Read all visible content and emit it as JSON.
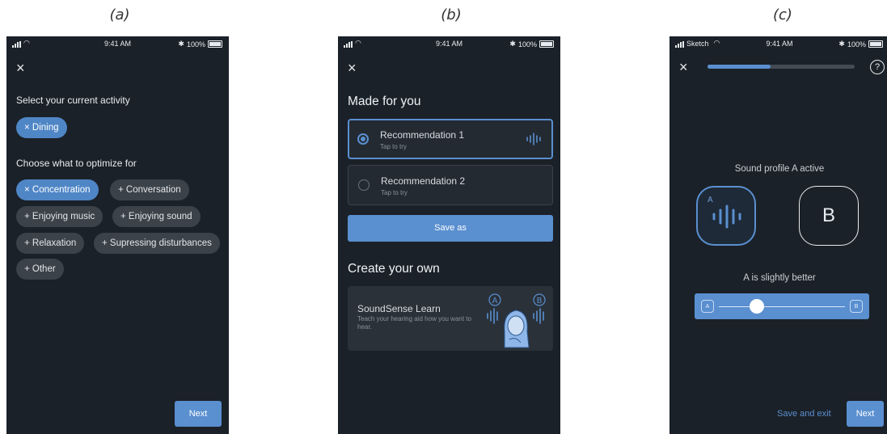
{
  "captions": {
    "a": "(a)",
    "b": "(b)",
    "c": "(c)"
  },
  "status": {
    "time": "9:41 AM",
    "battery": "100%",
    "carrier_c": "Sketch"
  },
  "screen_a": {
    "close_icon": "×",
    "activity_heading": "Select your current activity",
    "activity_chip": "× Dining",
    "optimize_heading": "Choose what to optimize for",
    "chips": [
      {
        "label": "× Concentration",
        "selected": true
      },
      {
        "label": "+ Conversation",
        "selected": false
      },
      {
        "label": "+ Enjoying music",
        "selected": false
      },
      {
        "label": "+ Enjoying sound",
        "selected": false
      },
      {
        "label": "+ Relaxation",
        "selected": false
      },
      {
        "label": "+ Supressing disturbances",
        "selected": false
      },
      {
        "label": "+ Other",
        "selected": false
      }
    ],
    "next_label": "Next"
  },
  "screen_b": {
    "close_icon": "×",
    "made_heading": "Made for you",
    "rec1_title": "Recommendation 1",
    "rec1_sub": "Tap to try",
    "rec2_title": "Recommendation 2",
    "rec2_sub": "Tap to try",
    "save_label": "Save as",
    "create_heading": "Create your own",
    "learn_title": "SoundSense Learn",
    "learn_desc": "Teach your hearing aid how you want to hear.",
    "learn_a": "A",
    "learn_b": "B"
  },
  "screen_c": {
    "close_icon": "×",
    "help_icon": "?",
    "progress": 0.43,
    "profile_status": "Sound profile A active",
    "profile_a": "A",
    "profile_b": "B",
    "rating_label": "A is slightly better",
    "slider_a": "A",
    "slider_b": "B",
    "slider_value": 0.3,
    "save_exit_label": "Save and exit",
    "next_label": "Next"
  },
  "colors": {
    "background": "#1b2128",
    "accent": "#5a8fd0",
    "chip": "#3b4249"
  }
}
